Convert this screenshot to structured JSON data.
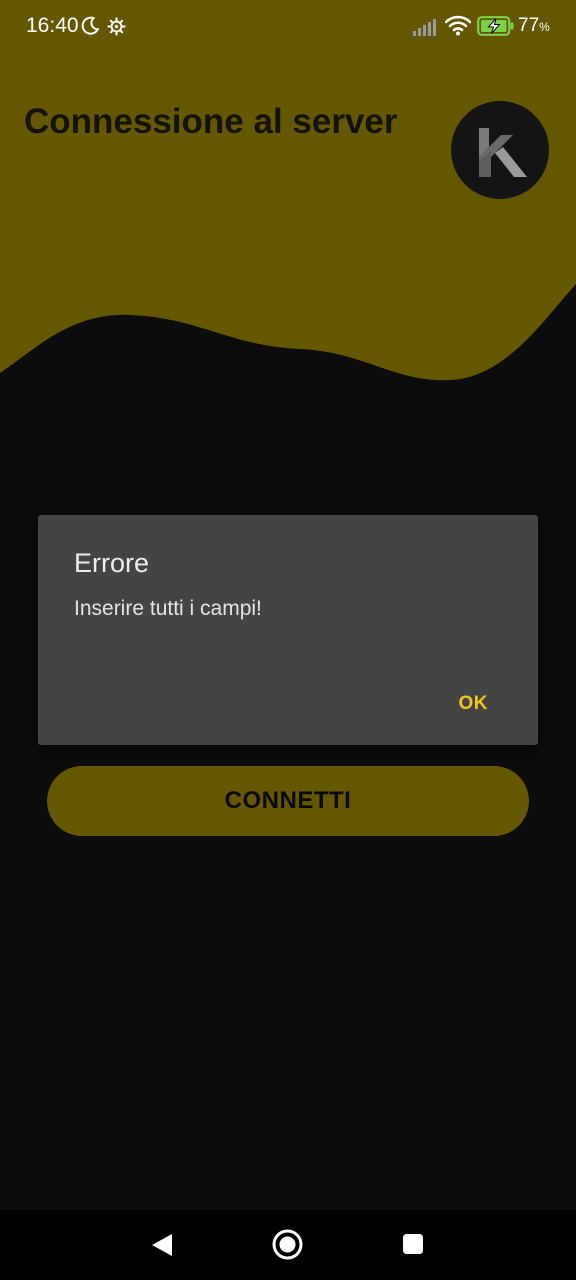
{
  "status_bar": {
    "time": "16:40",
    "battery_level": "77",
    "battery_unit": "%"
  },
  "header": {
    "title": "Connessione al server",
    "logo_letter": "K"
  },
  "dialog": {
    "title": "Errore",
    "message": "Inserire tutti i campi!",
    "ok_label": "OK"
  },
  "connect_button": {
    "label": "CONNETTI"
  },
  "icons": {
    "status": [
      "moon-icon",
      "gear-icon",
      "signal-icon",
      "wifi-icon",
      "battery-charging-icon"
    ],
    "nav": [
      "back-icon",
      "home-icon",
      "recent-apps-icon"
    ]
  },
  "colors": {
    "header_background": "#655600",
    "page_background": "#0c0c0c",
    "dialog_background": "#444444",
    "dialog_action": "#f3c517",
    "button_background": "#655600",
    "battery_charging": "#7bd14a"
  }
}
